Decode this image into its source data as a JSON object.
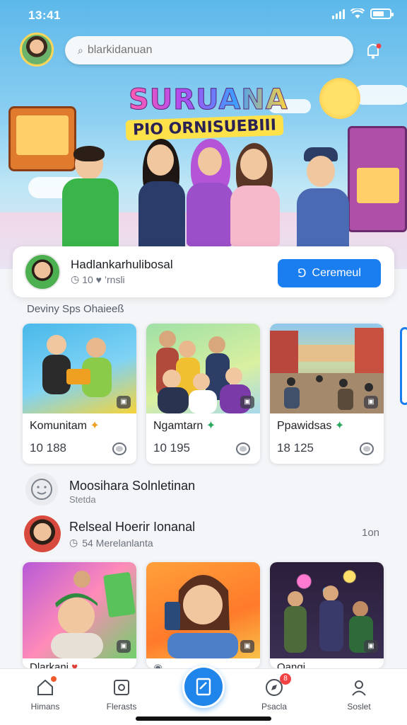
{
  "status_bar": {
    "time": "13:41"
  },
  "search": {
    "placeholder": "blarkidanuan"
  },
  "hero": {
    "title": "SURUANA",
    "subtitle": "PIO ORNISUEBIII"
  },
  "profile": {
    "name": "Hadlankarhulibosal",
    "meta": "10 ♥ ’rnsli",
    "button_label": "Ceremeul"
  },
  "section_label": "Deviny Sps Ohaieeß",
  "cards": [
    {
      "title": "Komunitam",
      "count": "10 188",
      "star_color": "#f0a020"
    },
    {
      "title": "Ngamtarn",
      "count": "10 195",
      "star_color": "#2aa860"
    },
    {
      "title": "Ppawidsas",
      "count": "18 125",
      "star_color": "#2aa860"
    }
  ],
  "feed": [
    {
      "title": "Moosihara Solnletinan",
      "subtitle": "Stetda"
    },
    {
      "title": "Relseal Hoerir Ionanal",
      "subtitle": "54 Merelanlanta",
      "time": "1on"
    }
  ],
  "cards_bottom": [
    {
      "title": "Dlarkani"
    },
    {
      "title": ""
    },
    {
      "title": "Qangi"
    }
  ],
  "bottom_nav": [
    {
      "label": "Himans",
      "icon": "home-icon"
    },
    {
      "label": "Flerasts",
      "icon": "square-icon"
    },
    {
      "label": "",
      "icon": "create-icon"
    },
    {
      "label": "Psacla",
      "icon": "compass-icon",
      "badge": "8"
    },
    {
      "label": "Soslet",
      "icon": "user-icon"
    }
  ],
  "colors": {
    "accent": "#1a7ef0",
    "sky": "#5cb8ea"
  }
}
